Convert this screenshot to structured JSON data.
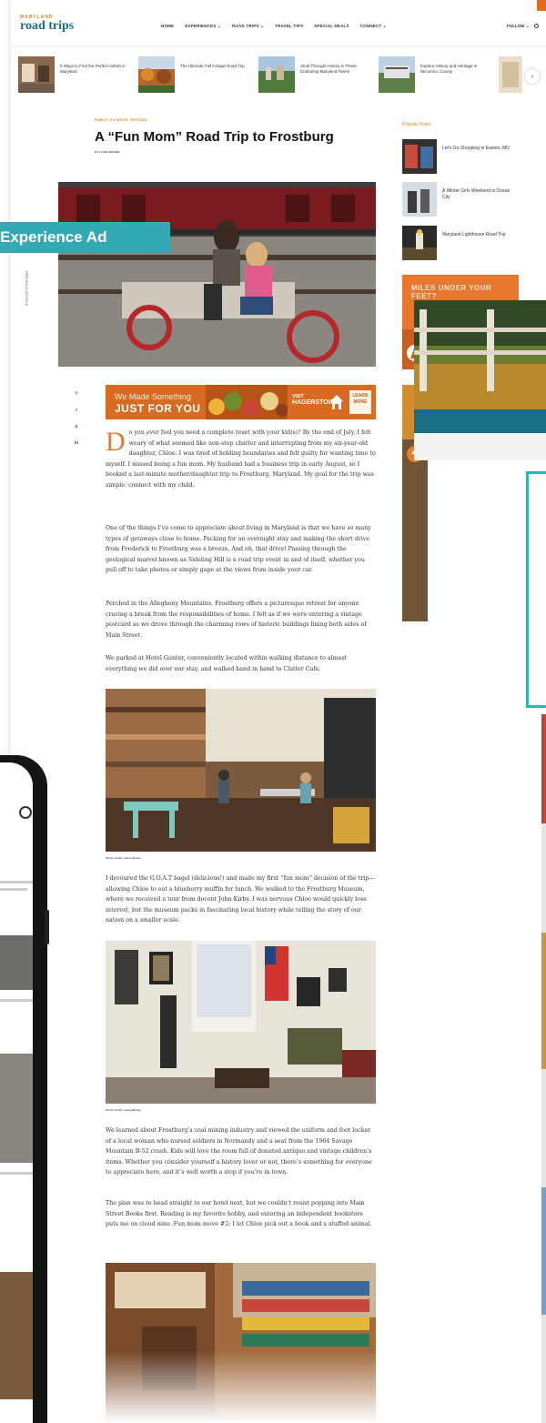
{
  "ad_label": "Experience Ad",
  "site": {
    "logo_small": "MARYLAND",
    "logo_main": "road trips",
    "nav": [
      "HOME",
      "EXPERIENCES ⌄",
      "ROAD TRIPS ⌄",
      "TRAVEL TIPS",
      "SPECIAL DEALS",
      "CONNECT ⌄"
    ],
    "follow": "FOLLOW ⌄"
  },
  "featured": [
    {
      "text": "5 Ways to Find the Perfect Airbnb in Maryland"
    },
    {
      "text": "The Ultimate Fall Foliage Road Trip"
    },
    {
      "text": "Stroll Through History in These Endearing Maryland Towns"
    },
    {
      "text": "Explore History and Heritage in Wicomico County"
    }
  ],
  "article": {
    "category": "FAMILY, OUTDOOR, SPOTTED",
    "title": "A “Fun Mom” Road Trip to Frostburg",
    "byline": "BY LAURA BENNIE",
    "share": [
      "f",
      "t",
      "p",
      "in"
    ],
    "previous_article": "PREVIOUS ARTICLE",
    "banner": {
      "line1": "We Made Something",
      "line2": "JUST FOR YOU",
      "brand_small": "VISIT",
      "brand": "HAGERSTOWN",
      "cta": "LEARN MORE"
    },
    "dropcap": "D",
    "p1": "o you ever feel you need a complete reset with your kid(s)? By the end of July, I felt weary of what seemed like non-stop chatter and interrupting from my six-year-old daughter, Chloe. I was tired of holding boundaries and felt guilty for wanting time to myself. I missed being a fun mom. My husband had a business trip in early August, so I booked a last-minute mother/daughter trip to Frostburg, Maryland. My goal for the trip was simple: connect with my child.",
    "p2": "One of the things I’ve come to appreciate about living in Maryland is that we have so many types of getaways close to home. Packing for an overnight stay and making the short drive from Frederick to Frostburg was a breeze. And oh, that drive! Passing through the geological marvel known as Sideling Hill is a road trip event in and of itself, whether you pull off to take photos or simply gape at the views from inside your car.",
    "p3": "Perched in the Allegheny Mountains, Frostburg offers a picturesque retreat for anyone craving a break from the responsibilities of home. I felt as if we were entering a vintage postcard as we drove through the charming rows of historic buildings lining both sides of Main Street.",
    "p4": "We parked at Hotel Gunter, conveniently located within walking distance to almost everything we did over our stay, and walked hand in hand to Clatter Cafe.",
    "caption1": "Photo Credit: Laura Bennie",
    "p5": "I devoured the G.O.A.T bagel (delicious!) and made my first “fun mom” decision of the trip—allowing Chloe to eat a blueberry muffin for lunch. We walked to the Frostburg Museum, where we received a tour from docent John Kirby. I was nervous Chloe would quickly lose interest, but the museum packs in fascinating local history while telling the story of our nation on a smaller scale.",
    "caption2": "Photo Credit: Laura Bennie",
    "p6": "We learned about Frostburg’s coal mining industry and viewed the uniform and foot locker of a local woman who nursed soldiers in Normandy and a seat from the 1964 Savage Mountain B-52 crash. Kids will love the room full of donated antique and vintage children’s items. Whether you consider yourself a history lover or not, there’s something for everyone to appreciate here, and it’s well worth a stop if you’re in town.",
    "p7": "The plan was to head straight to our hotel next, but we couldn’t resist popping into Main Street Books first. Reading is my favorite hobby, and entering an independent bookstore puts me on cloud nine. Fun mom move #2: I let Chloe pick out a book and a stuffed animal."
  },
  "sidebar": {
    "heading": "Popular Posts",
    "posts": [
      {
        "text": "Let’s Go Shopping in Easton, MD"
      },
      {
        "text": "A Winter Girls Weekend in Ocean City"
      },
      {
        "text": "Maryland Lighthouse Road Trip"
      }
    ],
    "ad_text": "MILES UNDER YOUR FEET?"
  },
  "colors": {
    "brand_teal": "#1d6f85",
    "accent_orange": "#d9822b",
    "label_teal": "#33a9b3"
  }
}
